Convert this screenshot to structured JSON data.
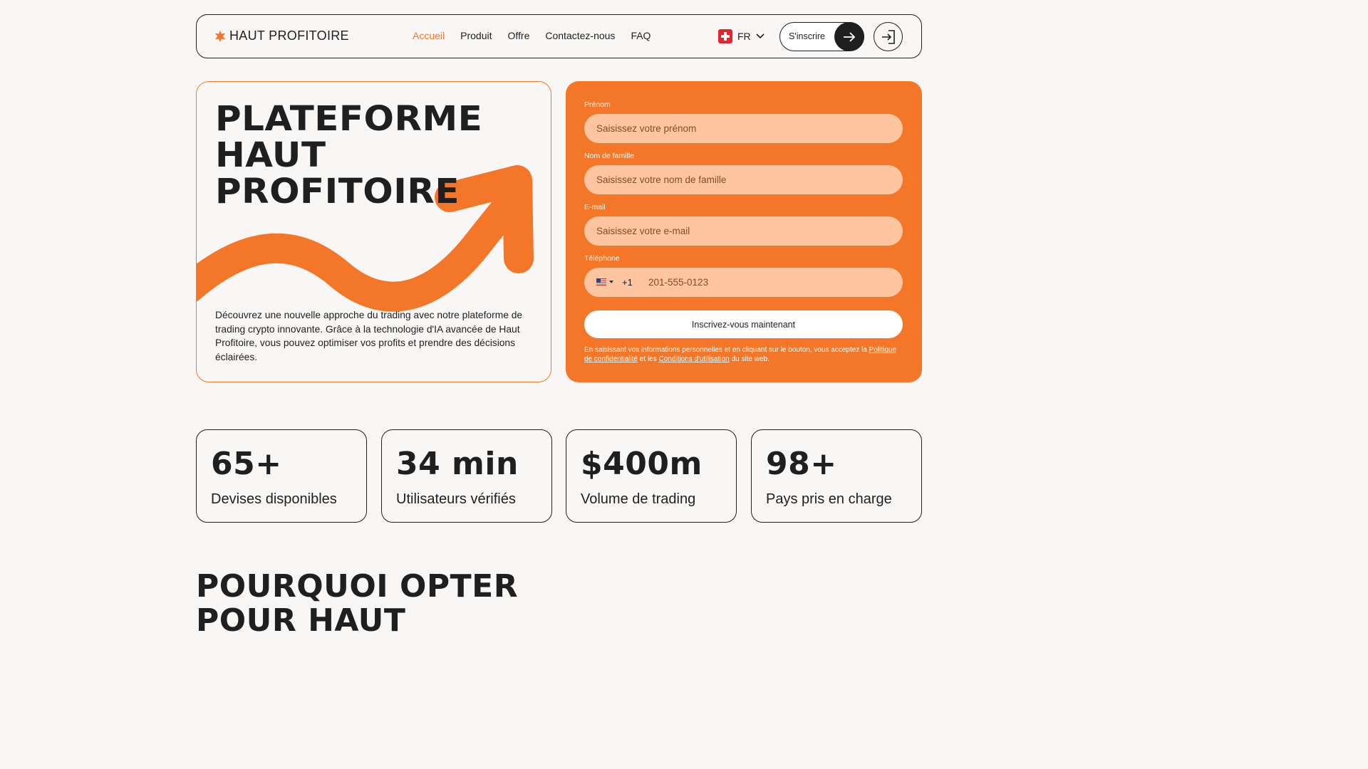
{
  "brand": {
    "name": "HAUT PROFITOIRE",
    "accent": "#f47729",
    "dark": "#1f1f1f"
  },
  "nav": {
    "links": [
      {
        "label": "Accueil",
        "active": true
      },
      {
        "label": "Produit",
        "active": false
      },
      {
        "label": "Offre",
        "active": false
      },
      {
        "label": "Contactez-nous",
        "active": false
      },
      {
        "label": "FAQ",
        "active": false
      }
    ],
    "language": "FR",
    "language_flag": "switzerland-flag-icon",
    "signup_label": "S'inscrire",
    "login_icon": "login-icon"
  },
  "hero": {
    "title_lines": [
      "PLATEFORME",
      "HAUT",
      "PROFITOIRE"
    ],
    "description": "Découvrez une nouvelle approche du trading avec notre plateforme de trading crypto innovante. Grâce à la technologie d'IA avancée de Haut Profitoire, vous pouvez optimiser vos profits et prendre des décisions éclairées."
  },
  "form": {
    "first_name": {
      "label": "Prénom",
      "placeholder": "Saisissez votre prénom",
      "value": ""
    },
    "last_name": {
      "label": "Nom de famille",
      "placeholder": "Saisissez votre nom de famille",
      "value": ""
    },
    "email": {
      "label": "E-mail",
      "placeholder": "Saisissez votre e-mail",
      "value": ""
    },
    "phone": {
      "label": "Téléphone",
      "country_flag": "us-flag-icon",
      "dial_code": "+1",
      "placeholder": "201-555-0123",
      "value": ""
    },
    "submit_label": "Inscrivez-vous maintenant",
    "legal_prefix": "En saisissant vos informations personnelles et en cliquant sur le bouton, vous acceptez la",
    "privacy_link": "Politique de confidentialité",
    "legal_and": "et les",
    "terms_link": "Conditions d'utilisation",
    "legal_suffix": "du site web."
  },
  "stats": [
    {
      "value": "65+",
      "label": "Devises disponibles"
    },
    {
      "value": "34 min",
      "label": "Utilisateurs vérifiés"
    },
    {
      "value": "$400m",
      "label": "Volume de trading"
    },
    {
      "value": "98+",
      "label": "Pays pris en charge"
    }
  ],
  "section": {
    "title_lines": [
      "POURQUOI OPTER",
      "POUR HAUT"
    ]
  }
}
